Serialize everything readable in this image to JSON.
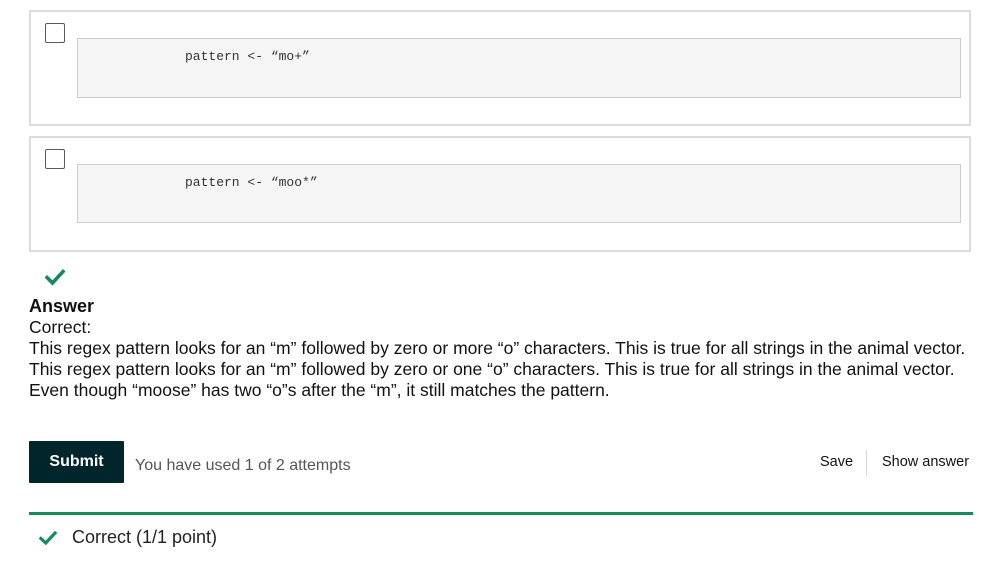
{
  "choices": [
    {
      "code": "pattern <- “mo+”",
      "checked": false
    },
    {
      "code": "pattern <- “moo*”",
      "checked": false
    }
  ],
  "answer": {
    "heading": "Answer",
    "status": "Correct:",
    "lines": [
      "This regex pattern looks for an “m” followed by zero or more “o” characters. This is true for all strings in the animal vector.",
      "This regex pattern looks for an “m” followed by zero or one “o” characters. This is true for all strings in the animal vector. Even though “moose” has two “o”s after the “m”, it still matches the pattern."
    ]
  },
  "actions": {
    "submit_label": "Submit",
    "attempts_text": "You have used 1 of 2 attempts",
    "save_label": "Save",
    "show_answer_label": "Show answer"
  },
  "result": {
    "text": "Correct (1/1 point)"
  },
  "colors": {
    "accent_green": "#178a5b",
    "submit_bg": "#00262b"
  },
  "icons": {
    "answer_check": "check-icon",
    "result_check": "check-icon"
  }
}
